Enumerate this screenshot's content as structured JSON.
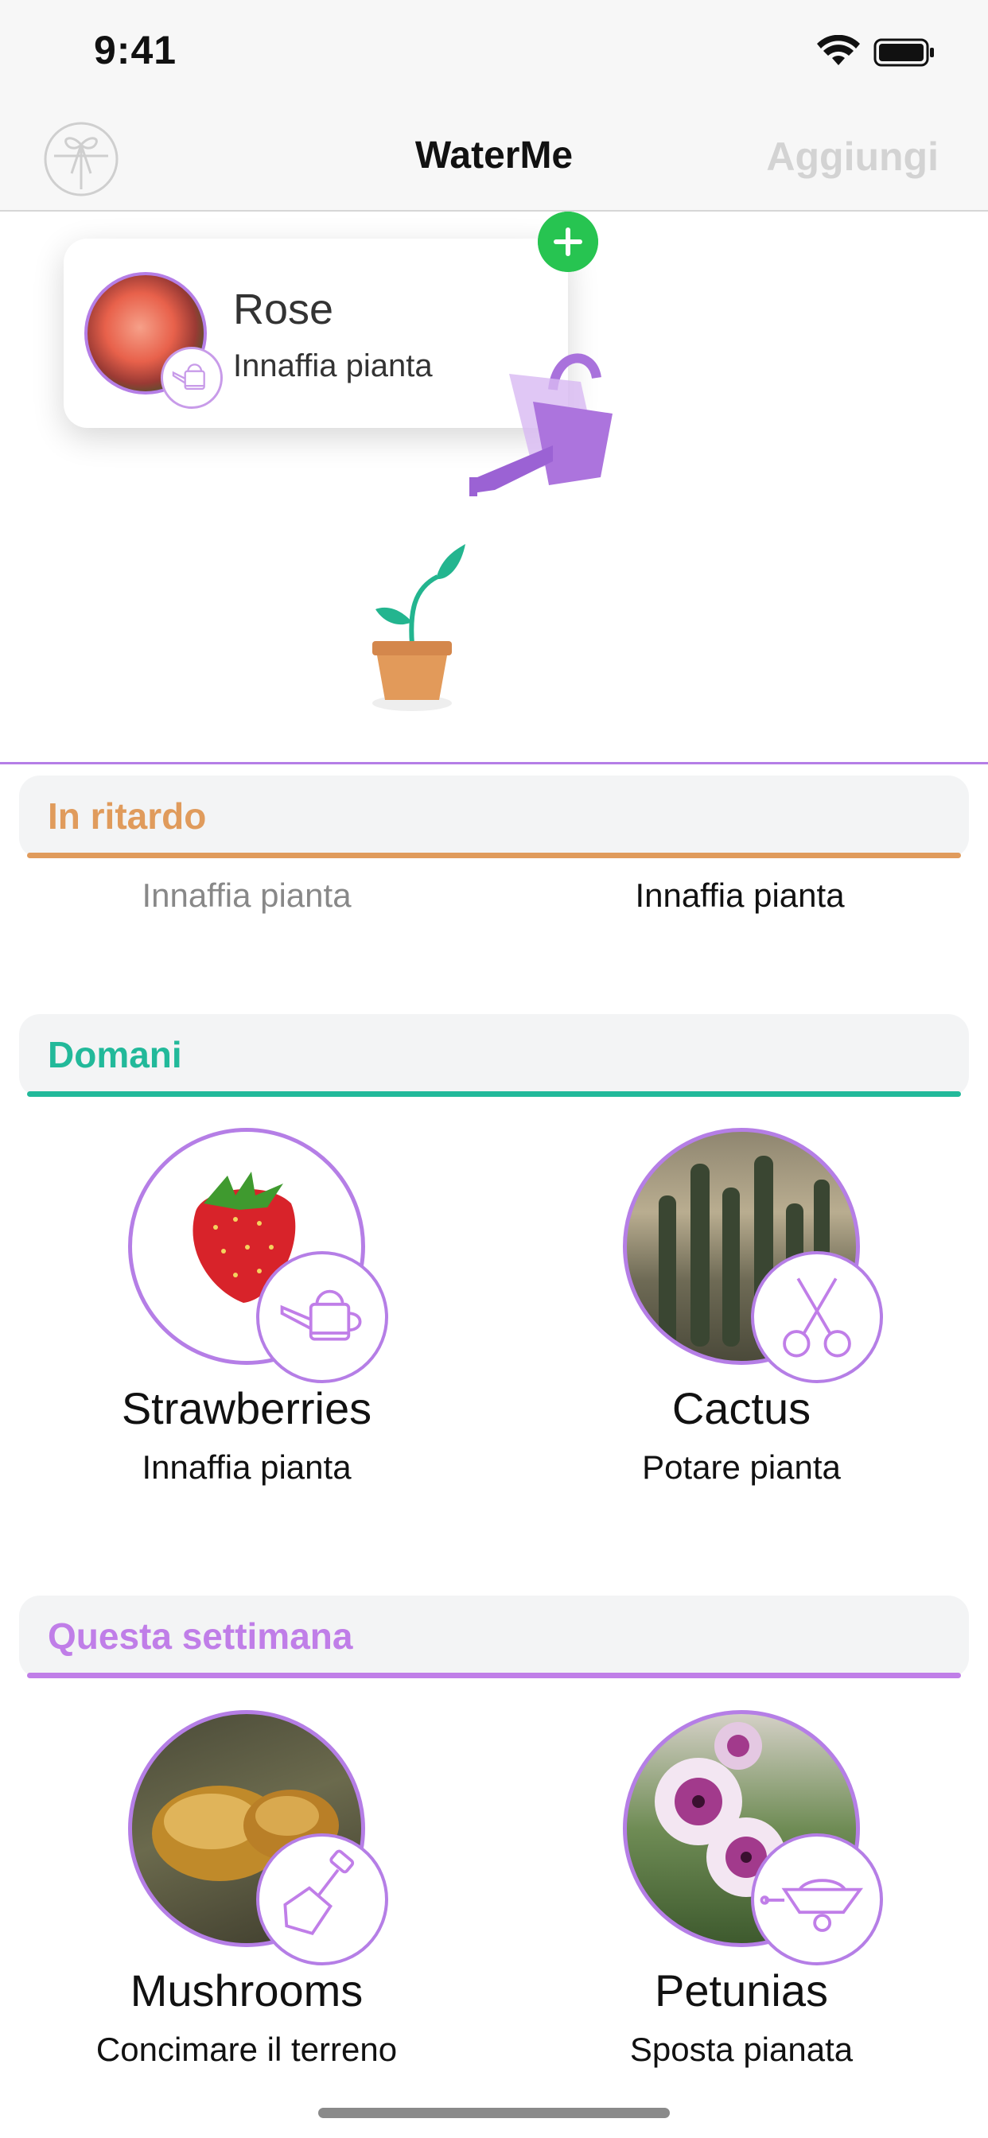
{
  "status_bar": {
    "time": "9:41"
  },
  "nav": {
    "title": "WaterMe",
    "add_label": "Aggiungi"
  },
  "drag_preview": {
    "name": "Rose",
    "task": "Innaffia pianta"
  },
  "sections": {
    "late": {
      "title": "In ritardo",
      "color": "#e09b5c",
      "items": [
        {
          "task": "Innaffia pianta"
        },
        {
          "task": "Innaffia pianta"
        }
      ]
    },
    "tomorrow": {
      "title": "Domani",
      "color": "#22b99a",
      "items": [
        {
          "name": "Strawberries",
          "task": "Innaffia pianta",
          "icon": "watering-can-icon"
        },
        {
          "name": "Cactus",
          "task": "Potare pianta",
          "icon": "scissors-icon"
        }
      ]
    },
    "this_week": {
      "title": "Questa settimana",
      "color": "#c07ee8",
      "items": [
        {
          "name": "Mushrooms",
          "task": "Concimare il terreno",
          "icon": "shovel-icon"
        },
        {
          "name": "Petunias",
          "task": "Sposta pianata",
          "icon": "wheelbarrow-icon"
        }
      ]
    }
  },
  "colors": {
    "accent": "#b57ee6",
    "add_green": "#27c451",
    "disabled": "#d3d3d3"
  }
}
